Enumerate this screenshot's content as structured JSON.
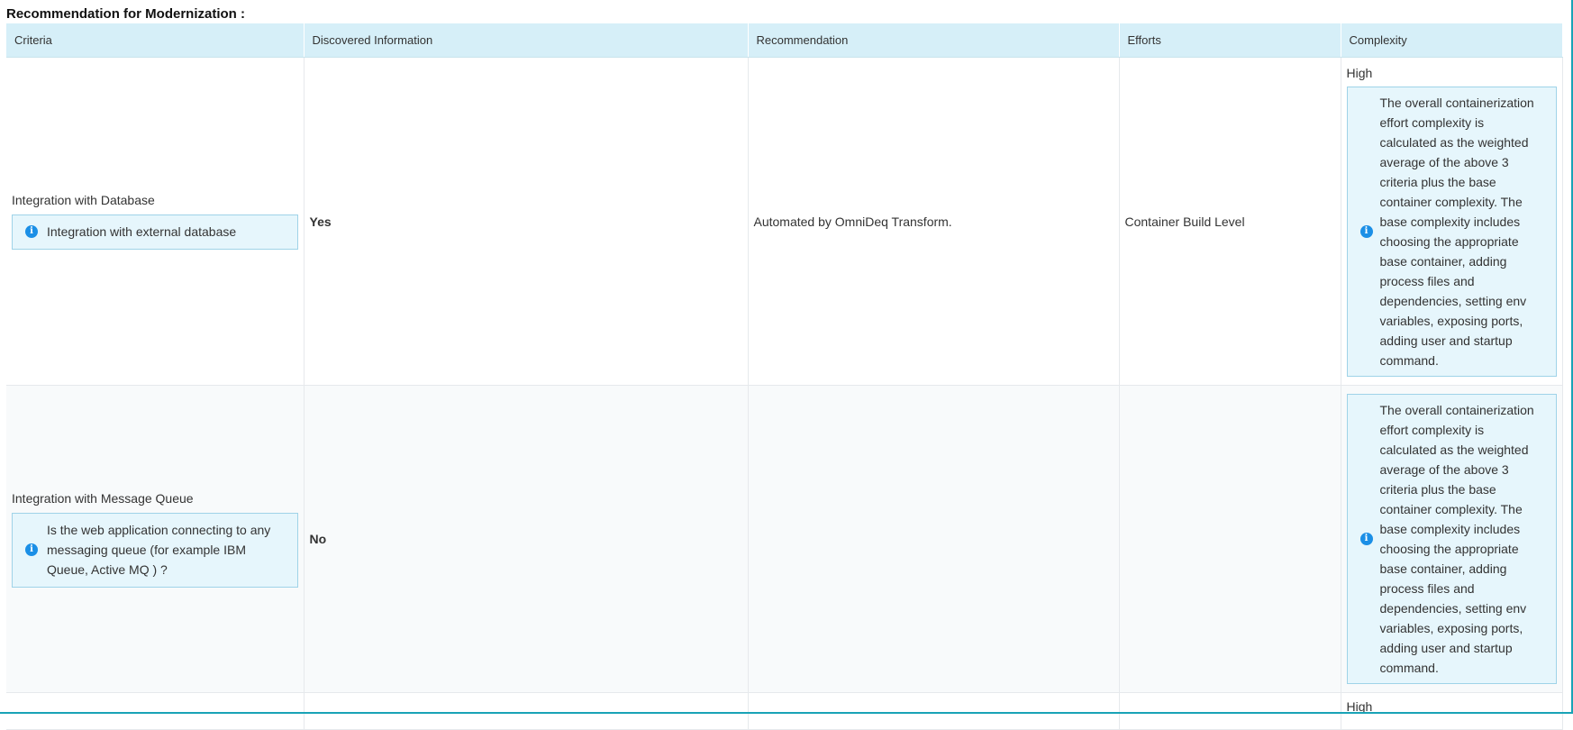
{
  "section_title": "Recommendation for Modernization :",
  "columns": [
    "Criteria",
    "Discovered Information",
    "Recommendation",
    "Efforts",
    "Complexity"
  ],
  "rows": [
    {
      "criteria": "Integration with Database",
      "criteria_info": "Integration with external database",
      "discovered": "Yes",
      "recommendation": "Automated by OmniDeq Transform.",
      "efforts": "Container Build Level",
      "complexity": "High",
      "complexity_info": "The overall containerization effort complexity is calculated as the weighted average of the above 3 criteria plus the base container complexity. The base complexity includes choosing the appropriate base container, adding process files and dependencies, setting env variables, exposing ports, adding user and startup command."
    },
    {
      "criteria": "Integration with Message Queue",
      "criteria_info": "Is the web application connecting to any messaging queue (for example IBM Queue, Active MQ ) ?",
      "discovered": "No",
      "recommendation": "",
      "efforts": "",
      "complexity": "",
      "complexity_info": "The overall containerization effort complexity is calculated as the weighted average of the above 3 criteria plus the base container complexity. The base complexity includes choosing the appropriate base container, adding process files and dependencies, setting env variables, exposing ports, adding user and startup command."
    },
    {
      "complexity": "High"
    }
  ],
  "icons": {
    "info": "info-circle-icon"
  },
  "colors": {
    "header_bg": "#d6eff8",
    "info_bg": "#e6f6fc",
    "info_border": "#9fd3e8",
    "icon": "#1b8fe6",
    "frame": "#19a3b6"
  }
}
